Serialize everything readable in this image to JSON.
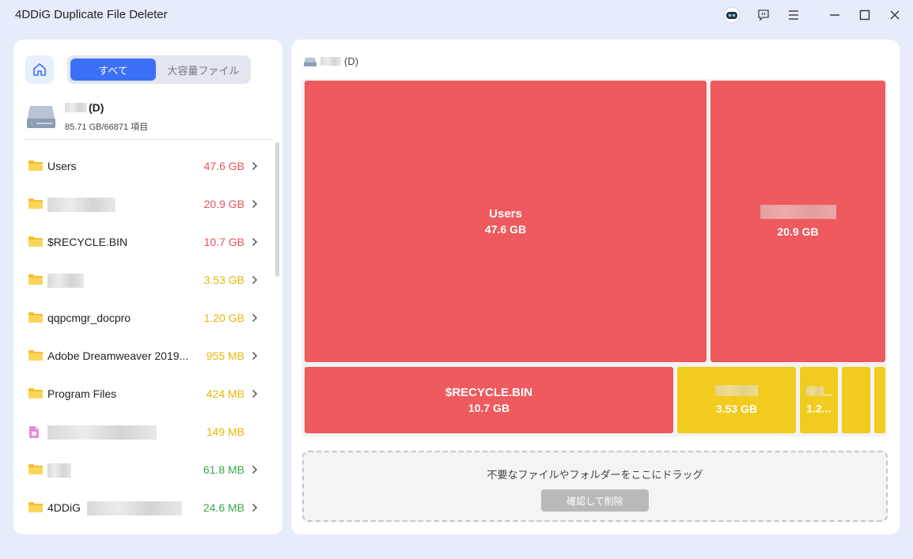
{
  "window": {
    "title": "4DDiG Duplicate File Deleter",
    "icons": [
      "robot-icon",
      "feedback-icon",
      "menu-icon",
      "minimize-icon",
      "maximize-icon",
      "close-icon"
    ]
  },
  "left": {
    "tabs": {
      "all": "すべて",
      "large": "大容量ファイル"
    },
    "drive": {
      "name": "(D)",
      "info": "85.71 GB/66871 項目"
    },
    "items": [
      {
        "name": "Users",
        "size": "47.6 GB",
        "color": "#e8505b",
        "type": "folder",
        "blur": false
      },
      {
        "name": "",
        "size": "20.9 GB",
        "color": "#e8505b",
        "type": "folder",
        "blur": true
      },
      {
        "name": "$RECYCLE.BIN",
        "size": "10.7 GB",
        "color": "#e8505b",
        "type": "folder",
        "blur": false
      },
      {
        "name": "",
        "size": "3.53 GB",
        "color": "#e6b800",
        "type": "folder",
        "blur": true
      },
      {
        "name": "qqpcmgr_docpro",
        "size": "1.20 GB",
        "color": "#e6b800",
        "type": "folder",
        "blur": false
      },
      {
        "name": "Adobe Dreamweaver 2019...",
        "size": "955 MB",
        "color": "#e6b800",
        "type": "folder",
        "blur": false
      },
      {
        "name": "Program Files",
        "size": "424 MB",
        "color": "#e6b800",
        "type": "folder",
        "blur": false
      },
      {
        "name": "",
        "size": "149 MB",
        "color": "#e6b800",
        "type": "file",
        "blur": true
      },
      {
        "name": "",
        "size": "61.8 MB",
        "color": "#3aa64a",
        "type": "folder",
        "blur": true
      },
      {
        "name": "4DDiG",
        "size": "24.6 MB",
        "color": "#3aa64a",
        "type": "folder",
        "blur": true
      }
    ]
  },
  "right": {
    "path": "(D)",
    "tiles": [
      {
        "name": "Users",
        "size": "47.6 GB"
      },
      {
        "name": "",
        "size": "20.9 GB"
      },
      {
        "name": "$RECYCLE.BIN",
        "size": "10.7 GB"
      },
      {
        "name": "",
        "size": "3.53 GB"
      },
      {
        "name": "",
        "size": "1.2..."
      }
    ],
    "drop_text": "不要なファイルやフォルダーをここにドラッグ",
    "confirm_label": "確認して削除"
  },
  "colors": {
    "accent": "#3b6ff5",
    "large": "#ee5a5d",
    "medium": "#f2cb1f",
    "small": "#3aa64a"
  }
}
